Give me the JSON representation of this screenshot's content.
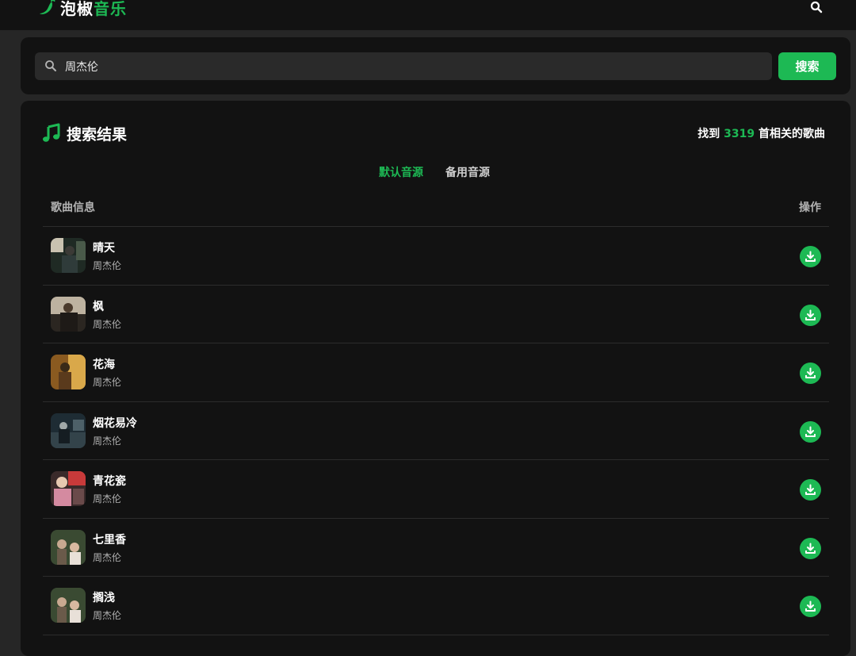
{
  "header": {
    "logo_part1": "泡椒",
    "logo_part2": "音乐",
    "logo_icon": "chili-pepper-icon",
    "search_icon": "search-icon"
  },
  "search": {
    "value": "周杰伦",
    "button_label": "搜索"
  },
  "results": {
    "title": "搜索结果",
    "count_prefix": "找到",
    "count_number": "3319",
    "count_suffix": "首相关的歌曲",
    "tabs": [
      {
        "label": "默认音源",
        "active": true
      },
      {
        "label": "备用音源",
        "active": false
      }
    ],
    "columns": {
      "info": "歌曲信息",
      "action": "操作"
    },
    "songs": [
      {
        "title": "晴天",
        "artist": "周杰伦"
      },
      {
        "title": "枫",
        "artist": "周杰伦"
      },
      {
        "title": "花海",
        "artist": "周杰伦"
      },
      {
        "title": "烟花易冷",
        "artist": "周杰伦"
      },
      {
        "title": "青花瓷",
        "artist": "周杰伦"
      },
      {
        "title": "七里香",
        "artist": "周杰伦"
      },
      {
        "title": "搁浅",
        "artist": "周杰伦"
      }
    ]
  },
  "colors": {
    "accent": "#1db954",
    "background": "#262626",
    "panel": "#121212"
  }
}
